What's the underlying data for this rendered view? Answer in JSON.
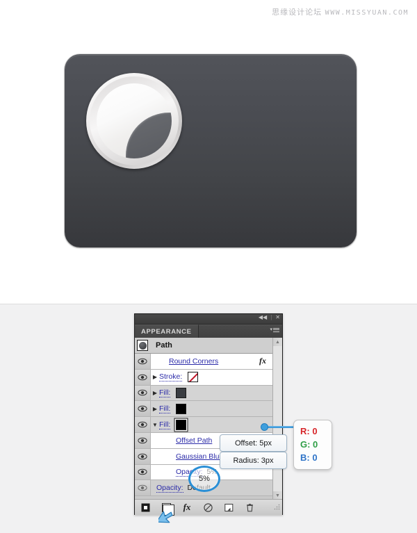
{
  "watermark": {
    "cn": "思缘设计论坛",
    "latin": "WWW.MISSYUAN.COM"
  },
  "artboard": {
    "name": "rounded-rect-icon-preview",
    "card_color": "#4b4d53",
    "knob_color": "#f2f0f0"
  },
  "panel": {
    "chrome": {
      "collapse_icon": "◀◀",
      "separator": "|",
      "close_icon": "✕"
    },
    "tab_label": "APPEARANCE",
    "menu_icon_caret": "▾",
    "header": {
      "title": "Path",
      "thumbnail": "path-thumbnail"
    },
    "rows": [
      {
        "id": "round-corners",
        "label": "Round Corners",
        "type": "effect",
        "has_fx": true,
        "fx_glyph": "fx",
        "eye": true,
        "triangle": "",
        "swatch": null
      },
      {
        "id": "stroke",
        "label": "Stroke:",
        "type": "stroke",
        "eye": true,
        "triangle": "▶",
        "swatch": "none",
        "swatch_color": "#ffffff"
      },
      {
        "id": "fill-1",
        "label": "Fill:",
        "type": "fill",
        "eye": true,
        "triangle": "▶",
        "swatch": "solid",
        "swatch_color": "#3a3d42"
      },
      {
        "id": "fill-2",
        "label": "Fill:",
        "type": "fill",
        "eye": true,
        "triangle": "▶",
        "swatch": "solid",
        "swatch_color": "#000000"
      },
      {
        "id": "fill-3",
        "label": "Fill:",
        "type": "fill",
        "eye": true,
        "triangle": "▼",
        "swatch": "solid",
        "swatch_color": "#000000",
        "selected": true
      },
      {
        "id": "offset-path",
        "label": "Offset Path",
        "type": "sub-effect",
        "eye": true,
        "triangle": ""
      },
      {
        "id": "gaussian-blur",
        "label": "Gaussian Blur",
        "type": "sub-effect",
        "eye": true,
        "triangle": ""
      },
      {
        "id": "opacity-sub",
        "label": "Opacity:",
        "type": "sub-opacity",
        "value": "5%",
        "eye": true,
        "triangle": ""
      },
      {
        "id": "opacity-main",
        "label": "Opacity:",
        "type": "opacity",
        "value": "Default",
        "eye": true,
        "triangle": ""
      }
    ],
    "scrollbar": {
      "up_arrow": "▲",
      "down_arrow": "▼"
    },
    "footer": {
      "buttons": [
        {
          "id": "add-new-stroke",
          "icon": "filled-square-icon",
          "label": "Add New Stroke"
        },
        {
          "id": "add-new-fill",
          "icon": "new-fill-square-icon",
          "label": "Add New Fill"
        },
        {
          "id": "add-new-effect",
          "icon": "fx-icon",
          "label": "Add New Effect",
          "glyph": "fx"
        },
        {
          "id": "clear-appearance",
          "icon": "circle-slash-icon",
          "label": "Clear Appearance"
        },
        {
          "id": "duplicate-item",
          "icon": "duplicate-icon",
          "label": "Duplicate Selected Item"
        },
        {
          "id": "delete-item",
          "icon": "trash-icon",
          "label": "Delete Selected Item"
        }
      ],
      "resize_grip": "resize-grip-icon"
    }
  },
  "annotations": {
    "offset_button": "Offset: 5px",
    "radius_button": "Radius: 3px",
    "opacity_highlight": "5%",
    "rgb": {
      "r": "R: 0",
      "g": "G: 0",
      "b": "B: 0",
      "r_color": "#d7262a",
      "g_color": "#2f9e46",
      "b_color": "#2f74c8"
    },
    "highlight_color": "#2a8fd6"
  }
}
